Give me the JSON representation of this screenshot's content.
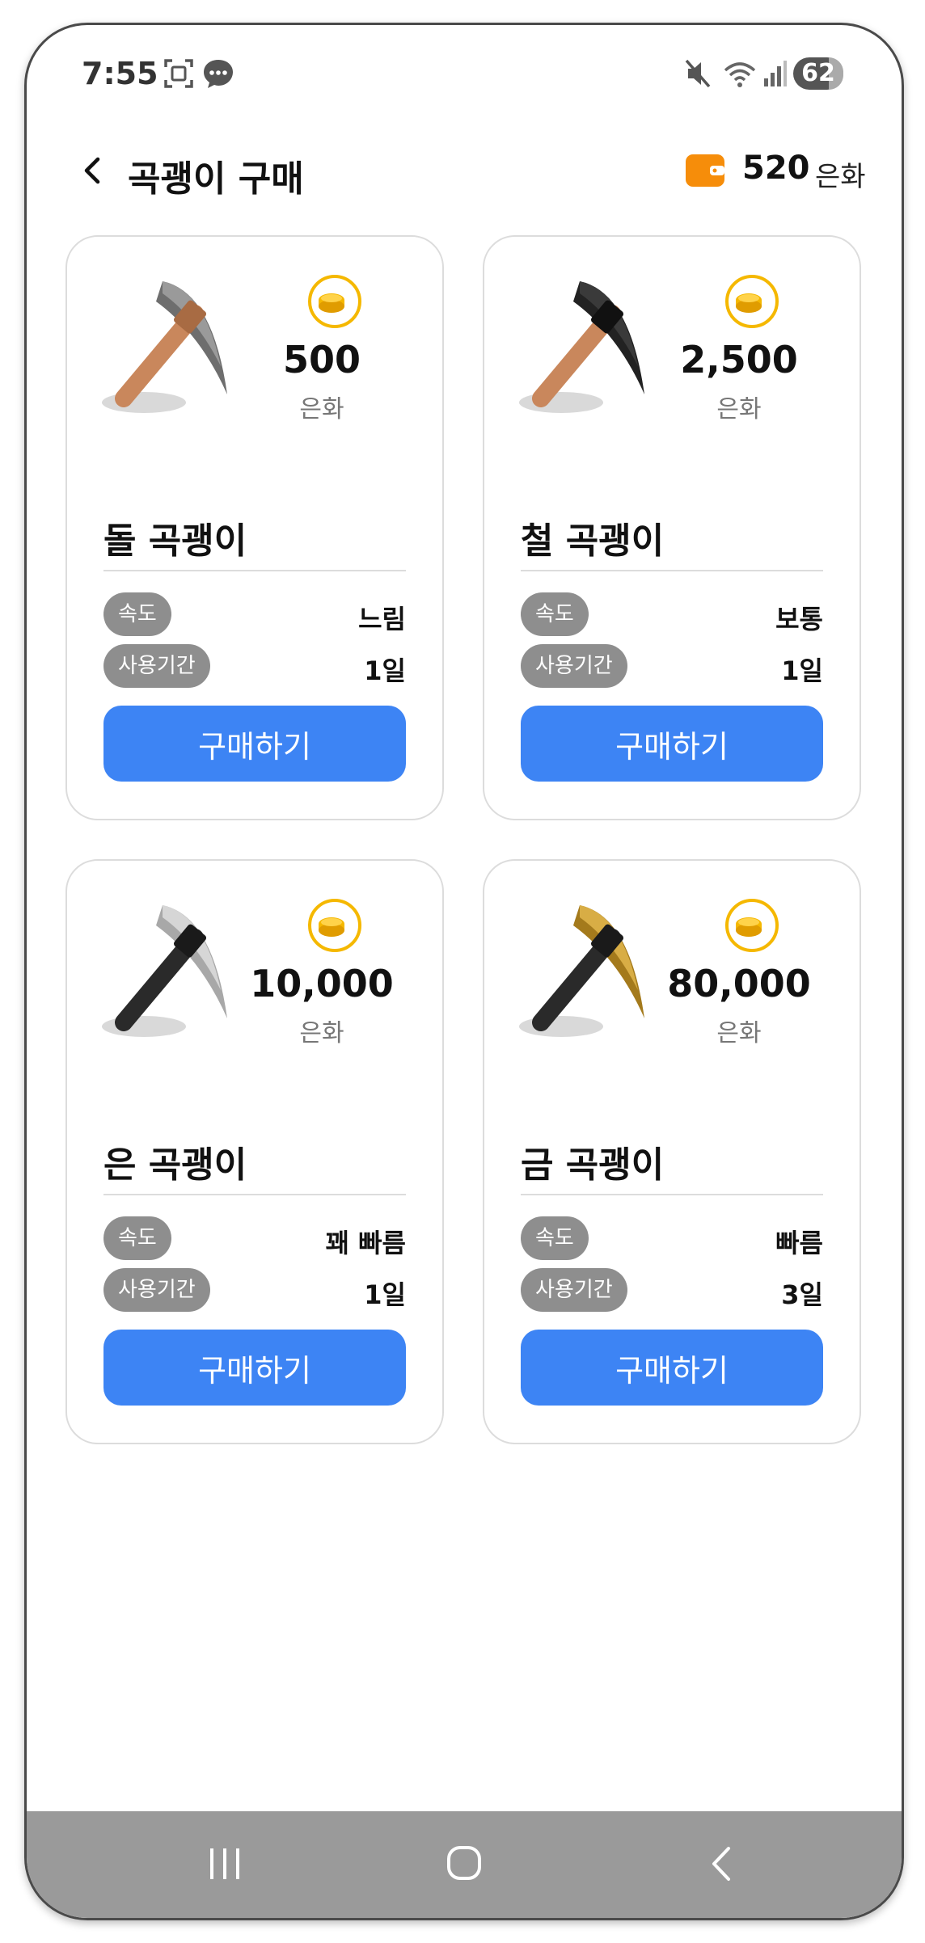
{
  "status_bar": {
    "time": "7:55",
    "battery": "62"
  },
  "header": {
    "title": "곡괭이 구매",
    "balance": "520",
    "balance_unit": "은화"
  },
  "colors": {
    "accent": "#3d84f4",
    "tag": "#8e8e8e",
    "wallet": "#f68d0a",
    "coin": "#f5b800"
  },
  "pickaxes": [
    {
      "name": "돌 곡괭이",
      "price": "500",
      "price_unit": "은화",
      "speed_label": "속도",
      "speed": "느림",
      "period_label": "사용기간",
      "period": "1일",
      "buy_label": "구매하기",
      "head_color": "#6e6e6e",
      "handle_color": "#c9875c"
    },
    {
      "name": "철 곡괭이",
      "price": "2,500",
      "price_unit": "은화",
      "speed_label": "속도",
      "speed": "보통",
      "period_label": "사용기간",
      "period": "1일",
      "buy_label": "구매하기",
      "head_color": "#222222",
      "handle_color": "#c9875c"
    },
    {
      "name": "은 곡괭이",
      "price": "10,000",
      "price_unit": "은화",
      "speed_label": "속도",
      "speed": "꽤 빠름",
      "period_label": "사용기간",
      "period": "1일",
      "buy_label": "구매하기",
      "head_color": "#c8c8c8",
      "handle_color": "#2a2a2a"
    },
    {
      "name": "금 곡괭이",
      "price": "80,000",
      "price_unit": "은화",
      "speed_label": "속도",
      "speed": "빠름",
      "period_label": "사용기간",
      "period": "3일",
      "buy_label": "구매하기",
      "head_color": "#c79a2e",
      "handle_color": "#2a2a2a"
    }
  ]
}
